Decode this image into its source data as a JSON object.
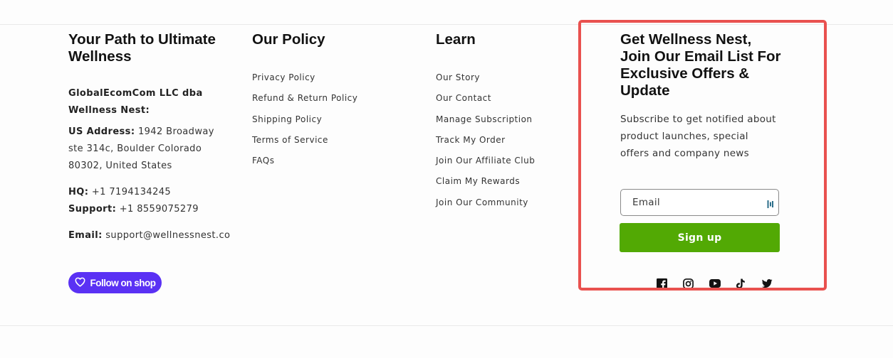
{
  "about": {
    "heading": "Your Path to Ultimate Wellness",
    "company": "GlobalEcomCom LLC dba Wellness Nest:",
    "address_label": "US Address:",
    "address_value": " 1942 Broadway ste 314c, Boulder Colorado 80302, United States",
    "hq_label": "HQ:",
    "hq_value": " +1 7194134245",
    "support_label": "Support:",
    "support_value": " +1 8559075279",
    "email_label": "Email:",
    "email_value": " support@wellnessnest.co",
    "follow_label": "Follow on shop"
  },
  "policy": {
    "heading": "Our Policy",
    "links": [
      "Privacy Policy",
      "Refund & Return Policy",
      "Shipping Policy",
      "Terms of Service",
      "FAQs"
    ]
  },
  "learn": {
    "heading": "Learn",
    "links": [
      "Our Story",
      "Our Contact",
      "Manage Subscription",
      "Track My Order",
      "Join Our Affiliate Club",
      "Claim My Rewards",
      "Join Our Community"
    ]
  },
  "newsletter": {
    "heading": "Get Wellness Nest, Join Our Email List For Exclusive Offers & Update",
    "text": "Subscribe to get notified about product launches, special offers and company news",
    "email_placeholder": "Email",
    "signup_label": "Sign up"
  },
  "socials": [
    "facebook-icon",
    "instagram-icon",
    "youtube-icon",
    "tiktok-icon",
    "twitter-icon"
  ],
  "colors": {
    "shop_purple": "#5a31f4",
    "signup_green": "#52a904",
    "highlight_red": "#e9514f"
  }
}
